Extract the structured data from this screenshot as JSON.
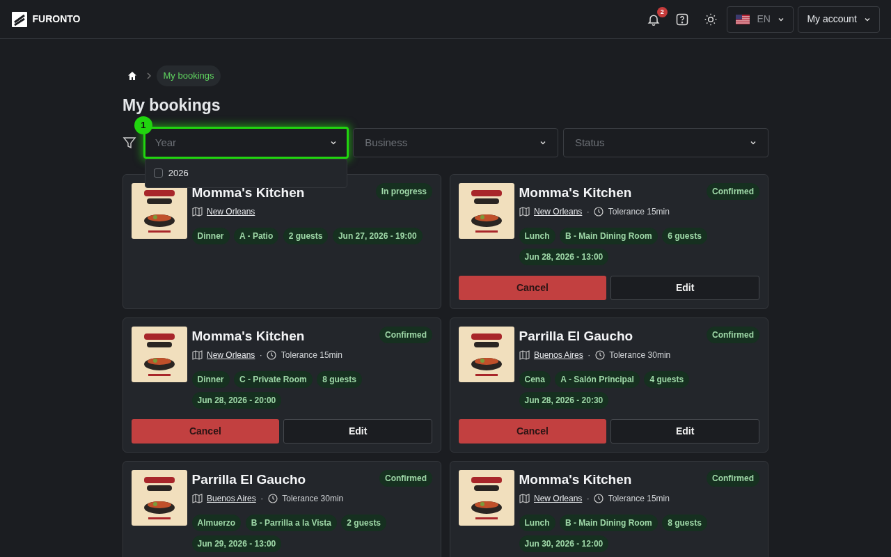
{
  "navbar": {
    "brand": "FURONTO",
    "notifications": {
      "count": "2"
    },
    "language": "EN",
    "account": "My account"
  },
  "breadcrumb": {
    "current": "My bookings"
  },
  "title": "My bookings",
  "filters": [
    {
      "placeholder": "Year",
      "highlighted": true,
      "step": "1",
      "open": true,
      "options": [
        {
          "label": "2026",
          "checked": false
        }
      ]
    },
    {
      "placeholder": "Business",
      "highlighted": false
    },
    {
      "placeholder": "Status",
      "highlighted": false
    }
  ],
  "bookings": [
    {
      "logo": {
        "kind": "picture"
      },
      "name": "Momma's Kitchen",
      "status": "In progress",
      "city": "New Orleans",
      "tags": [
        "Dinner",
        "A - Patio",
        "2 guests",
        "Jun 27, 2026 - 19:00"
      ]
    },
    {
      "logo": {
        "kind": "picture"
      },
      "name": "Momma's Kitchen",
      "status": "Confirmed",
      "city": "New Orleans",
      "separator": "·",
      "tolerance": "Tolerance 15min",
      "tags": [
        "Lunch",
        "B - Main Dining Room",
        "6 guests",
        "Jun 28, 2026 - 13:00"
      ],
      "actions": [
        "Cancel",
        "Edit"
      ]
    },
    {
      "logo": {
        "kind": "picture"
      },
      "name": "Momma's Kitchen",
      "status": "Confirmed",
      "city": "New Orleans",
      "separator": "·",
      "tolerance": "Tolerance 15min",
      "tags": [
        "Dinner",
        "C - Private Room",
        "8 guests",
        "Jun 28, 2026 - 20:00"
      ],
      "actions": [
        "Cancel",
        "Edit"
      ]
    },
    {
      "logo": {
        "kind": "picture"
      },
      "name": "Parrilla El Gaucho",
      "status": "Confirmed",
      "city": "Buenos Aires",
      "separator": "·",
      "tolerance": "Tolerance 30min",
      "tags": [
        "Cena",
        "A - Salón Principal",
        "4 guests",
        "Jun 28, 2026 - 20:30"
      ],
      "actions": [
        "Cancel",
        "Edit"
      ]
    },
    {
      "logo": {
        "kind": "picture"
      },
      "name": "Parrilla El Gaucho",
      "status": "Confirmed",
      "city": "Buenos Aires",
      "separator": "·",
      "tolerance": "Tolerance 30min",
      "tags": [
        "Almuerzo",
        "B - Parrilla a la Vista",
        "2 guests",
        "Jun 29, 2026 - 13:00"
      ]
    },
    {
      "logo": {
        "kind": "picture"
      },
      "name": "Momma's Kitchen",
      "status": "Confirmed",
      "city": "New Orleans",
      "separator": "·",
      "tolerance": "Tolerance 15min",
      "tags": [
        "Lunch",
        "B - Main Dining Room",
        "8 guests",
        "Jun 30, 2026 - 12:00"
      ]
    }
  ]
}
